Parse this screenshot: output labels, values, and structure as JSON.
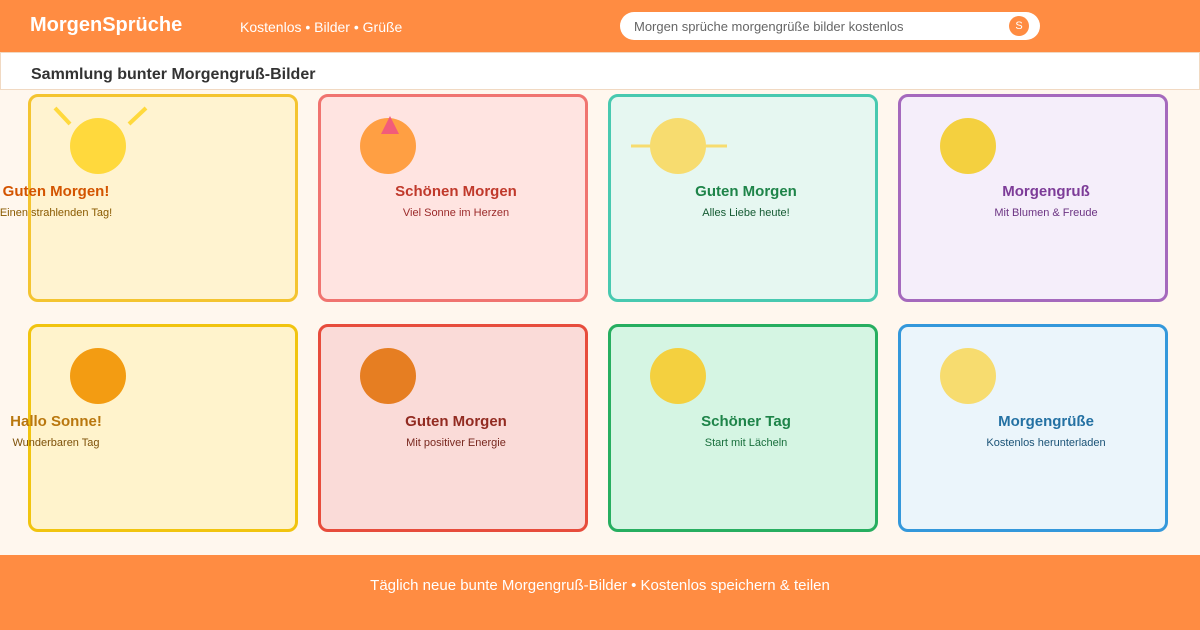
{
  "header": {
    "brand": "MorgenSprüche",
    "nav_text": "Kostenlos • Bilder • Grüße",
    "search": {
      "placeholder": "Morgen sprüche morgengrüße bilder kostenlos",
      "button_label": "S"
    }
  },
  "section": {
    "title": "Sammlung bunter Morgengruß-Bilder"
  },
  "cards": [
    {
      "title": "Guten Morgen!",
      "subtitle": "Einen strahlenden Tag!",
      "bg": "#fff3d0",
      "border": "#f4c430",
      "title_color": "#d35400",
      "sub_color": "#8a5a00",
      "sun": "#ffd93d",
      "deco": "rays"
    },
    {
      "title": "Schönen Morgen",
      "subtitle": "Viel Sonne im Herzen",
      "bg": "#ffe4e1",
      "border": "#f07470",
      "title_color": "#c0392b",
      "sub_color": "#9b2a2a",
      "sun": "#ff9f43",
      "deco": "triangle"
    },
    {
      "title": "Guten Morgen",
      "subtitle": "Alles Liebe heute!",
      "bg": "#e6f7f1",
      "border": "#48c9b0",
      "title_color": "#1e8449",
      "sub_color": "#145a32",
      "sun": "#f7dc6f",
      "deco": "line"
    },
    {
      "title": "Morgengruß",
      "subtitle": "Mit Blumen & Freude",
      "bg": "#f5eefa",
      "border": "#a569bd",
      "title_color": "#7d3c98",
      "sub_color": "#6c3483",
      "sun": "#f4d03f",
      "deco": "none"
    },
    {
      "title": "Hallo Sonne!",
      "subtitle": "Wunderbaren Tag",
      "bg": "#fff3cc",
      "border": "#f1c40f",
      "title_color": "#b9770e",
      "sub_color": "#7e5109",
      "sun": "#f39c12",
      "deco": "none"
    },
    {
      "title": "Guten Morgen",
      "subtitle": "Mit positiver Energie",
      "bg": "#fadbd8",
      "border": "#e74c3c",
      "title_color": "#922b21",
      "sub_color": "#78281f",
      "sun": "#e67e22",
      "deco": "none"
    },
    {
      "title": "Schöner Tag",
      "subtitle": "Start mit Lächeln",
      "bg": "#d5f5e3",
      "border": "#27ae60",
      "title_color": "#1e8449",
      "sub_color": "#196f3d",
      "sun": "#f4d03f",
      "deco": "none"
    },
    {
      "title": "Morgengrüße",
      "subtitle": "Kostenlos herunterladen",
      "bg": "#ebf5fb",
      "border": "#3498db",
      "title_color": "#2471a3",
      "sub_color": "#1a5276",
      "sun": "#f7dc6f",
      "deco": "none"
    }
  ],
  "footer": {
    "text": "Täglich neue bunte Morgengruß-Bilder • Kostenlos speichern & teilen"
  },
  "colors": {
    "accent": "#ff8c42",
    "page_bg": "#fff7ee"
  }
}
